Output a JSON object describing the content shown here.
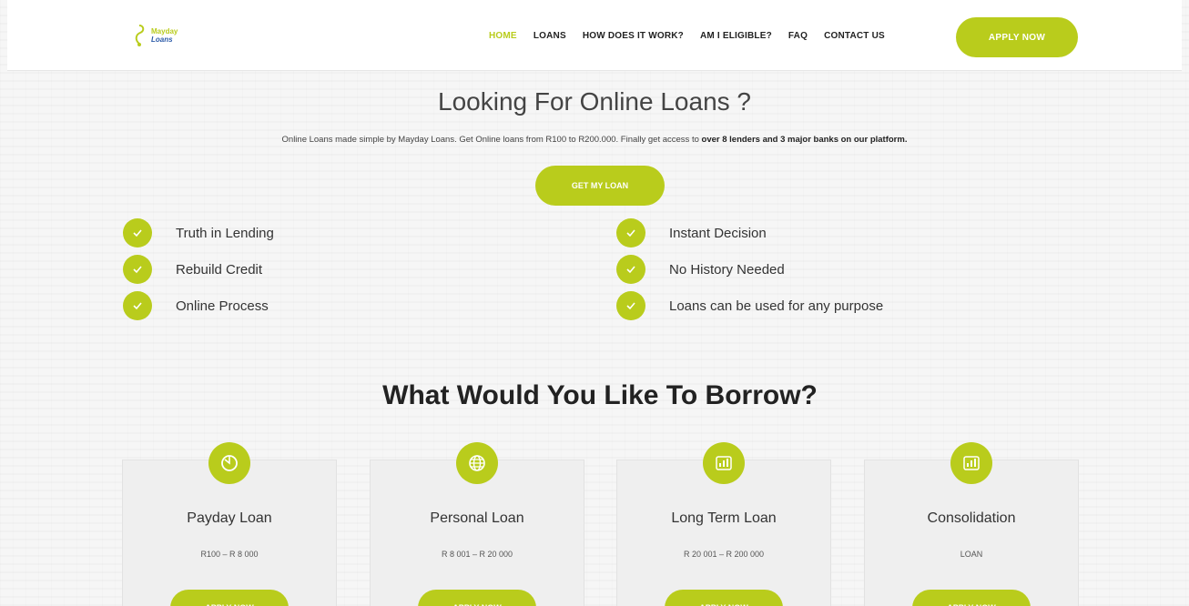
{
  "brand": {
    "logo_line1": "Mayday",
    "logo_line2": "Loans",
    "accent_color": "#b9cc1c"
  },
  "nav": {
    "items": [
      {
        "label": "HOME",
        "active": true
      },
      {
        "label": "LOANS",
        "active": false
      },
      {
        "label": "HOW DOES IT WORK?",
        "active": false
      },
      {
        "label": "AM I ELIGIBLE?",
        "active": false
      },
      {
        "label": "FAQ",
        "active": false
      },
      {
        "label": "CONTACT US",
        "active": false
      }
    ],
    "apply_label": "APPLY NOW"
  },
  "hero": {
    "title": "Looking For Online Loans ?",
    "subtitle_plain": "Online Loans made simple by Mayday Loans. Get Online loans from R100 to R200.000. Finally get access to ",
    "subtitle_bold": "over 8 lenders and 3 major banks on our platform.",
    "cta_label": "GET MY LOAN"
  },
  "features": {
    "left": [
      "Truth in Lending",
      "Rebuild Credit",
      "Online Process"
    ],
    "right": [
      "Instant Decision",
      "No History Needed",
      "Loans can be used for any purpose"
    ]
  },
  "borrow": {
    "title": "What Would You Like To Borrow?",
    "cards": [
      {
        "title": "Payday Loan",
        "range": "R100 – R 8 000",
        "icon": "clock-icon",
        "button": "APPLY NOW"
      },
      {
        "title": "Personal Loan",
        "range": "R 8 001 – R 20 000",
        "icon": "globe-icon",
        "button": "APPLY NOW"
      },
      {
        "title": "Long Term Loan",
        "range": "R 20 001 – R 200 000",
        "icon": "bar-chart-icon",
        "button": "APPLY NOW"
      },
      {
        "title": "Consolidation",
        "range": "LOAN",
        "icon": "bar-chart-icon",
        "button": "APPLY NOW"
      }
    ]
  }
}
